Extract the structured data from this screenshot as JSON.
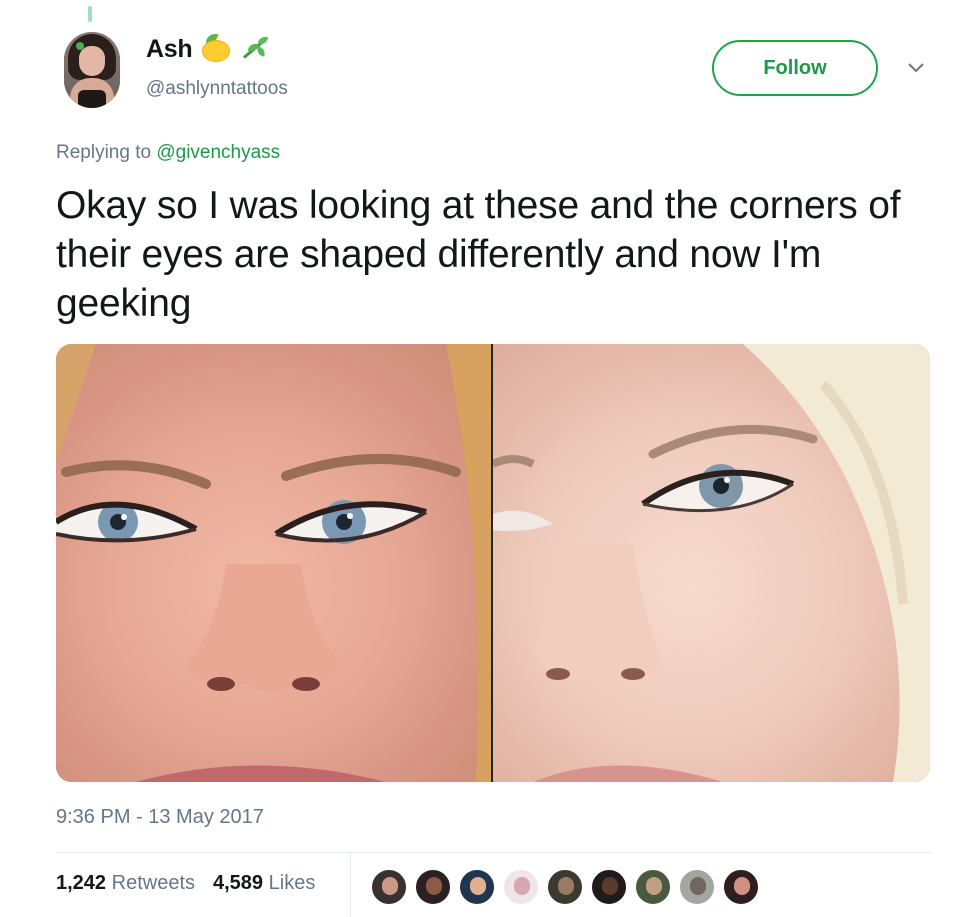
{
  "author": {
    "name": "Ash",
    "handle": "@ashlynntattoos",
    "name_emojis": [
      "lemon-icon",
      "herb-icon"
    ]
  },
  "follow_button": {
    "label": "Follow"
  },
  "reply": {
    "prefix": "Replying to",
    "mention": "@givenchyass"
  },
  "tweet": {
    "text": "Okay so I was looking at these and the corners of their eyes are shaped differently and now I'm geeking"
  },
  "media": {
    "images": [
      "photo-left",
      "photo-right"
    ]
  },
  "timestamp": "9:36 PM - 13 May 2017",
  "stats": {
    "retweets_count": "1,242",
    "retweets_label": "Retweets",
    "likes_count": "4,589",
    "likes_label": "Likes"
  },
  "colors": {
    "accent": "#1d9a48",
    "secondary_text": "#657786",
    "primary_text": "#14171a",
    "divider": "#e6ecf0"
  },
  "liker_avatars": [
    {
      "bg": "#3b3030",
      "face": "#c89a86"
    },
    {
      "bg": "#2a2222",
      "face": "#8f5a44"
    },
    {
      "bg": "#1f3550",
      "face": "#e0b090"
    },
    {
      "bg": "#f0e6ea",
      "face": "#d8a8b0"
    },
    {
      "bg": "#3c3a2e",
      "face": "#9a7a60"
    },
    {
      "bg": "#201a1a",
      "face": "#5a3a2a"
    },
    {
      "bg": "#4a5a40",
      "face": "#c0a080"
    },
    {
      "bg": "#a0a8a0",
      "face": "#706860"
    },
    {
      "bg": "#2e1e1e",
      "face": "#d09080"
    }
  ]
}
